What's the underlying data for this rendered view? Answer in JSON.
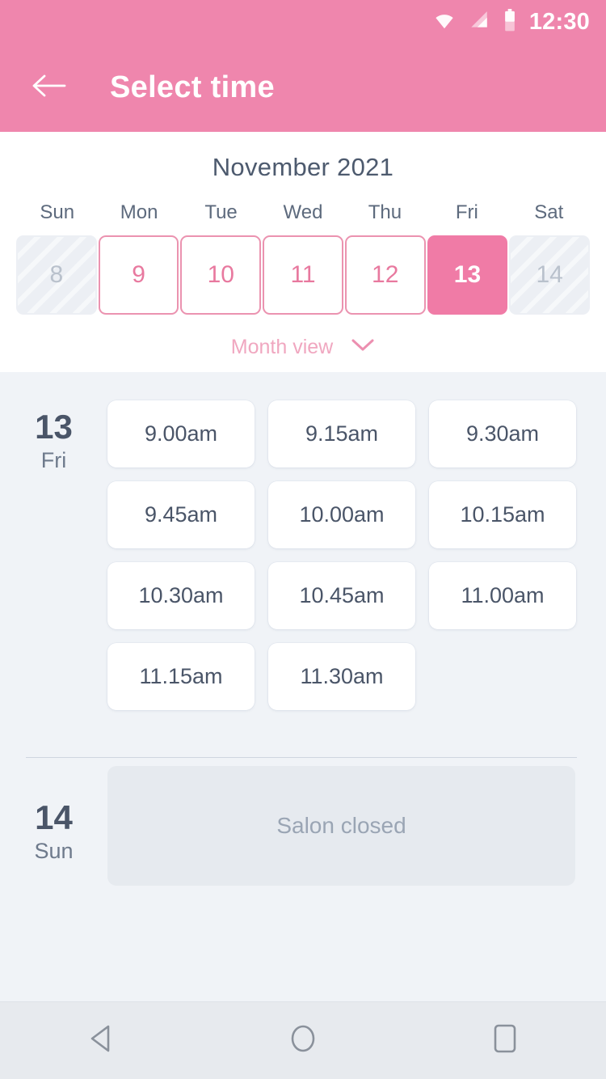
{
  "status_bar": {
    "time": "12:30",
    "icons": [
      "wifi-icon",
      "signal-icon",
      "battery-icon"
    ]
  },
  "app_bar": {
    "back_icon": "arrow-left-icon",
    "title": "Select time"
  },
  "calendar": {
    "month_title": "November 2021",
    "weekdays": [
      "Sun",
      "Mon",
      "Tue",
      "Wed",
      "Thu",
      "Fri",
      "Sat"
    ],
    "days": [
      {
        "num": "8",
        "state": "disabled"
      },
      {
        "num": "9",
        "state": "available"
      },
      {
        "num": "10",
        "state": "available"
      },
      {
        "num": "11",
        "state": "available"
      },
      {
        "num": "12",
        "state": "available"
      },
      {
        "num": "13",
        "state": "selected"
      },
      {
        "num": "14",
        "state": "disabled"
      }
    ],
    "month_view_label": "Month view",
    "month_view_icon": "chevron-down-icon"
  },
  "schedule": [
    {
      "day_num": "13",
      "day_of_week": "Fri",
      "slots": [
        "9.00am",
        "9.15am",
        "9.30am",
        "9.45am",
        "10.00am",
        "10.15am",
        "10.30am",
        "10.45am",
        "11.00am",
        "11.15am",
        "11.30am"
      ]
    },
    {
      "day_num": "14",
      "day_of_week": "Sun",
      "closed_label": "Salon closed"
    }
  ],
  "nav_bar": {
    "back": "nav-back-icon",
    "home": "nav-home-icon",
    "recents": "nav-recents-icon"
  },
  "colors": {
    "brand_pink": "#ef86ad",
    "selected_pink": "#f07ba6",
    "border_pink": "#eb93b0",
    "soft_pink": "#f0a7c0",
    "slate": "#4a5568",
    "page_bg": "#f0f3f7",
    "disabled_bg": "#eceff4",
    "closed_bg": "#e6eaef"
  }
}
